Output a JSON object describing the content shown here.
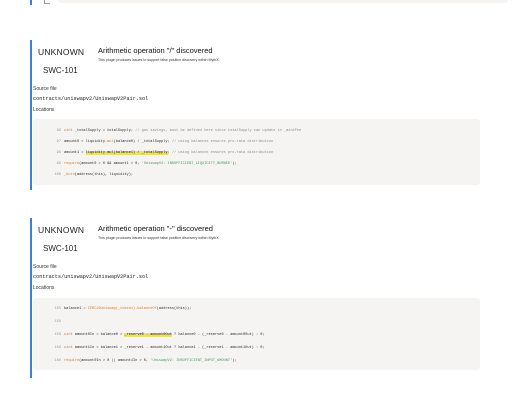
{
  "issues": [
    {
      "severity": "UNKNOWN",
      "swc": "SWC-101",
      "title": "Arithmetic operation \"/\" discovered",
      "description": "This plugin produces issues to support false positive discovery within MythX.",
      "source_label": "Source file",
      "source_path": "contracts/uniswapv2/UniswapV2Pair.sol",
      "locations_label": "Locations",
      "code_lines": [
        {
          "num": "96",
          "tokens": [
            {
              "t": "uint ",
              "c": "kw"
            },
            {
              "t": "_totalSupply = totalSupply; ",
              "c": ""
            },
            {
              "t": "// gas savings, must be defined here since totalSupply can update in _mintFee",
              "c": "cm"
            }
          ]
        },
        {
          "num": "97",
          "tokens": [
            {
              "t": "amount0 = liquidity.",
              "c": ""
            },
            {
              "t": "mul",
              "c": "kw"
            },
            {
              "t": "(balance0) / _totalSupply; ",
              "c": ""
            },
            {
              "t": "// using balances ensures pro-rata distribution",
              "c": "cm"
            }
          ]
        },
        {
          "num": "98",
          "tokens": [
            {
              "t": "amount1 = ",
              "c": ""
            },
            {
              "t": "liquidity.mul(balance1) / _totalSupply",
              "c": "hl"
            },
            {
              "t": "; ",
              "c": ""
            },
            {
              "t": "// using balances ensures pro-rata distribution",
              "c": "cm"
            }
          ]
        },
        {
          "num": "99",
          "tokens": [
            {
              "t": "require",
              "c": "kw"
            },
            {
              "t": "(amount0 > 0 && amount1 > 0, ",
              "c": ""
            },
            {
              "t": "'UniswapV2: INSUFFICIENT_LIQUIDITY_BURNED'",
              "c": "st"
            },
            {
              "t": ");",
              "c": ""
            }
          ]
        },
        {
          "num": "100",
          "tokens": [
            {
              "t": "_burn",
              "c": "fn"
            },
            {
              "t": "(address(this), liquidity);",
              "c": ""
            }
          ]
        }
      ]
    },
    {
      "severity": "UNKNOWN",
      "swc": "SWC-101",
      "title": "Arithmetic operation \"-\" discovered",
      "description": "This plugin produces issues to support false positive discovery within MythX.",
      "source_label": "Source file",
      "source_path": "contracts/uniswapv2/UniswapV2Pair.sol",
      "locations_label": "Locations",
      "code_lines": [
        {
          "num": "155",
          "tokens": [
            {
              "t": "balance1 = ",
              "c": ""
            },
            {
              "t": "IERC20Uniswap(_token1).balanceOf",
              "c": "kw"
            },
            {
              "t": "(address(this));",
              "c": ""
            }
          ]
        },
        {
          "num": "156",
          "tokens": []
        },
        {
          "num": "158",
          "tokens": [
            {
              "t": "uint ",
              "c": "kw"
            },
            {
              "t": "amount0In = balance0 > ",
              "c": ""
            },
            {
              "t": "_reserve0 - amount0Out",
              "c": "hl"
            },
            {
              "t": " ? balance0 - (_reserve0 - amount0Out) : 0;",
              "c": ""
            }
          ]
        },
        {
          "num": "159",
          "tokens": [
            {
              "t": "uint ",
              "c": "kw"
            },
            {
              "t": "amount1In = balance1 > _reserve1 - amount1Out ? balance1 - (_reserve1 - amount1Out) : 0;",
              "c": ""
            }
          ]
        },
        {
          "num": "160",
          "tokens": [
            {
              "t": "require",
              "c": "kw"
            },
            {
              "t": "(amount0In > 0 || amount1In > 0, ",
              "c": ""
            },
            {
              "t": "'UniswapV2: INSUFFICIENT_INPUT_AMOUNT'",
              "c": "st"
            },
            {
              "t": ");",
              "c": ""
            }
          ]
        }
      ]
    }
  ]
}
